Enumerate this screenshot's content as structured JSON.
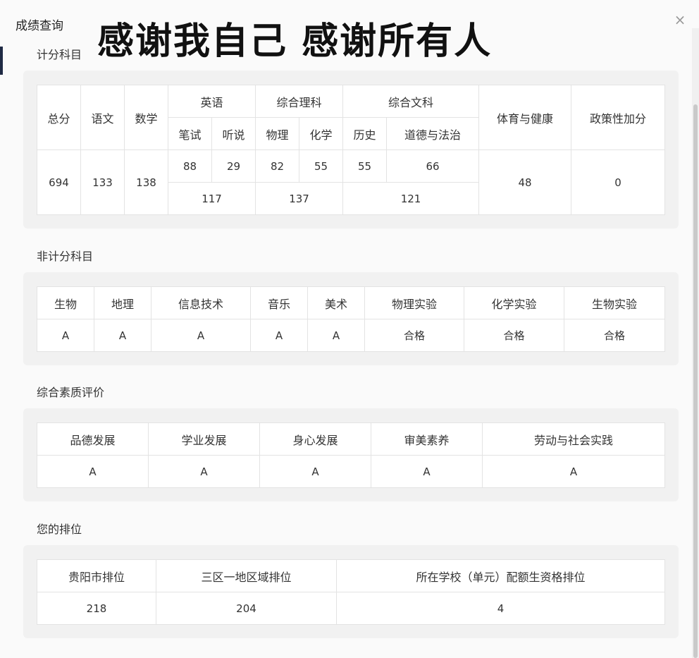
{
  "dialog": {
    "title": "成绩查询",
    "overlay_caption": "感谢我自己 感谢所有人",
    "close_glyph": "×"
  },
  "scored": {
    "title": "计分科目",
    "headers": {
      "total": "总分",
      "chinese": "语文",
      "math": "数学",
      "english": "英语",
      "english_written": "笔试",
      "english_oral": "听说",
      "science": "综合理科",
      "physics": "物理",
      "chemistry": "化学",
      "arts": "综合文科",
      "history": "历史",
      "morality_law": "道德与法治",
      "pe_health": "体育与健康",
      "policy_bonus": "政策性加分"
    },
    "values": {
      "total": "694",
      "chinese": "133",
      "math": "138",
      "english_written": "88",
      "english_oral": "29",
      "physics": "82",
      "chemistry": "55",
      "history": "55",
      "morality_law": "66",
      "english_sum": "117",
      "science_sum": "137",
      "arts_sum": "121",
      "pe_health": "48",
      "policy_bonus": "0"
    }
  },
  "unscored": {
    "title": "非计分科目",
    "headers": [
      "生物",
      "地理",
      "信息技术",
      "音乐",
      "美术",
      "物理实验",
      "化学实验",
      "生物实验"
    ],
    "values": [
      "A",
      "A",
      "A",
      "A",
      "A",
      "合格",
      "合格",
      "合格"
    ]
  },
  "quality": {
    "title": "综合素质评价",
    "headers": [
      "品德发展",
      "学业发展",
      "身心发展",
      "审美素养",
      "劳动与社会实践"
    ],
    "values": [
      "A",
      "A",
      "A",
      "A",
      "A"
    ]
  },
  "ranking": {
    "title": "您的排位",
    "headers": [
      "贵阳市排位",
      "三区一地区域排位",
      "所在学校（单元）配额生资格排位"
    ],
    "values": [
      "218",
      "204",
      "4"
    ]
  },
  "colors": {
    "highlight": "#c8762a",
    "card_bg": "#f1f1f1",
    "border": "#e3e3e3"
  }
}
